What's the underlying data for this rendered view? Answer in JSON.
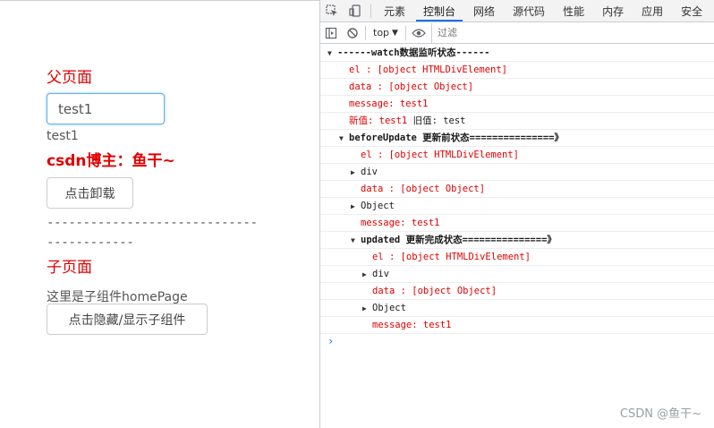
{
  "app": {
    "parent_title": "父页面",
    "input_value": "test1",
    "echo_text": "test1",
    "blogger_text": "csdn博主：鱼干~",
    "unmount_button": "点击卸载",
    "divider": "-----------------------------------------",
    "child_title": "子页面",
    "child_desc": "这里是子组件homePage",
    "toggle_button": "点击隐藏/显示子组件"
  },
  "devtools": {
    "tabs": [
      "元素",
      "控制台",
      "网络",
      "源代码",
      "性能",
      "内存",
      "应用",
      "安全"
    ],
    "active_tab": "控制台",
    "context": "top",
    "filter_placeholder": "过滤",
    "console": [
      {
        "text": "------watch数据监听状态------",
        "indent": 0,
        "color": "black",
        "expand": "open",
        "group": true
      },
      {
        "text": "el     : [object HTMLDivElement]",
        "indent": 1,
        "color": "red"
      },
      {
        "text": "data   : [object Object]",
        "indent": 1,
        "color": "red"
      },
      {
        "text": "message: test1",
        "indent": 1,
        "color": "red"
      },
      {
        "text": "新值: test1 旧值: test",
        "indent": 1,
        "color": "mixed"
      },
      {
        "text": "beforeUpdate 更新前状态===============》",
        "indent": 1,
        "color": "black",
        "expand": "open",
        "group": true
      },
      {
        "text": "el     : [object HTMLDivElement]",
        "indent": 2,
        "color": "red"
      },
      {
        "text": "div",
        "indent": 2,
        "color": "black",
        "expand": "closed"
      },
      {
        "text": "data   : [object Object]",
        "indent": 2,
        "color": "red"
      },
      {
        "text": "Object",
        "indent": 2,
        "color": "black",
        "expand": "closed"
      },
      {
        "text": "message: test1",
        "indent": 2,
        "color": "red"
      },
      {
        "text": "updated 更新完成状态===============》",
        "indent": 2,
        "color": "black",
        "expand": "open",
        "group": true
      },
      {
        "text": "el     : [object HTMLDivElement]",
        "indent": 3,
        "color": "red"
      },
      {
        "text": "div",
        "indent": 3,
        "color": "black",
        "expand": "closed"
      },
      {
        "text": "data   : [object Object]",
        "indent": 3,
        "color": "red"
      },
      {
        "text": "Object",
        "indent": 3,
        "color": "black",
        "expand": "closed"
      },
      {
        "text": "message: test1",
        "indent": 3,
        "color": "red"
      }
    ],
    "prompt_symbol": "›"
  },
  "watermark": "CSDN @鱼干~",
  "colors": {
    "accent_red": "#e00000",
    "focus_blue": "#66afe9",
    "tab_underline": "#1a73e8"
  },
  "icons": [
    "inspect-icon",
    "device-toolbar-icon",
    "sidebar-icon",
    "clear-console-icon",
    "eye-icon"
  ]
}
